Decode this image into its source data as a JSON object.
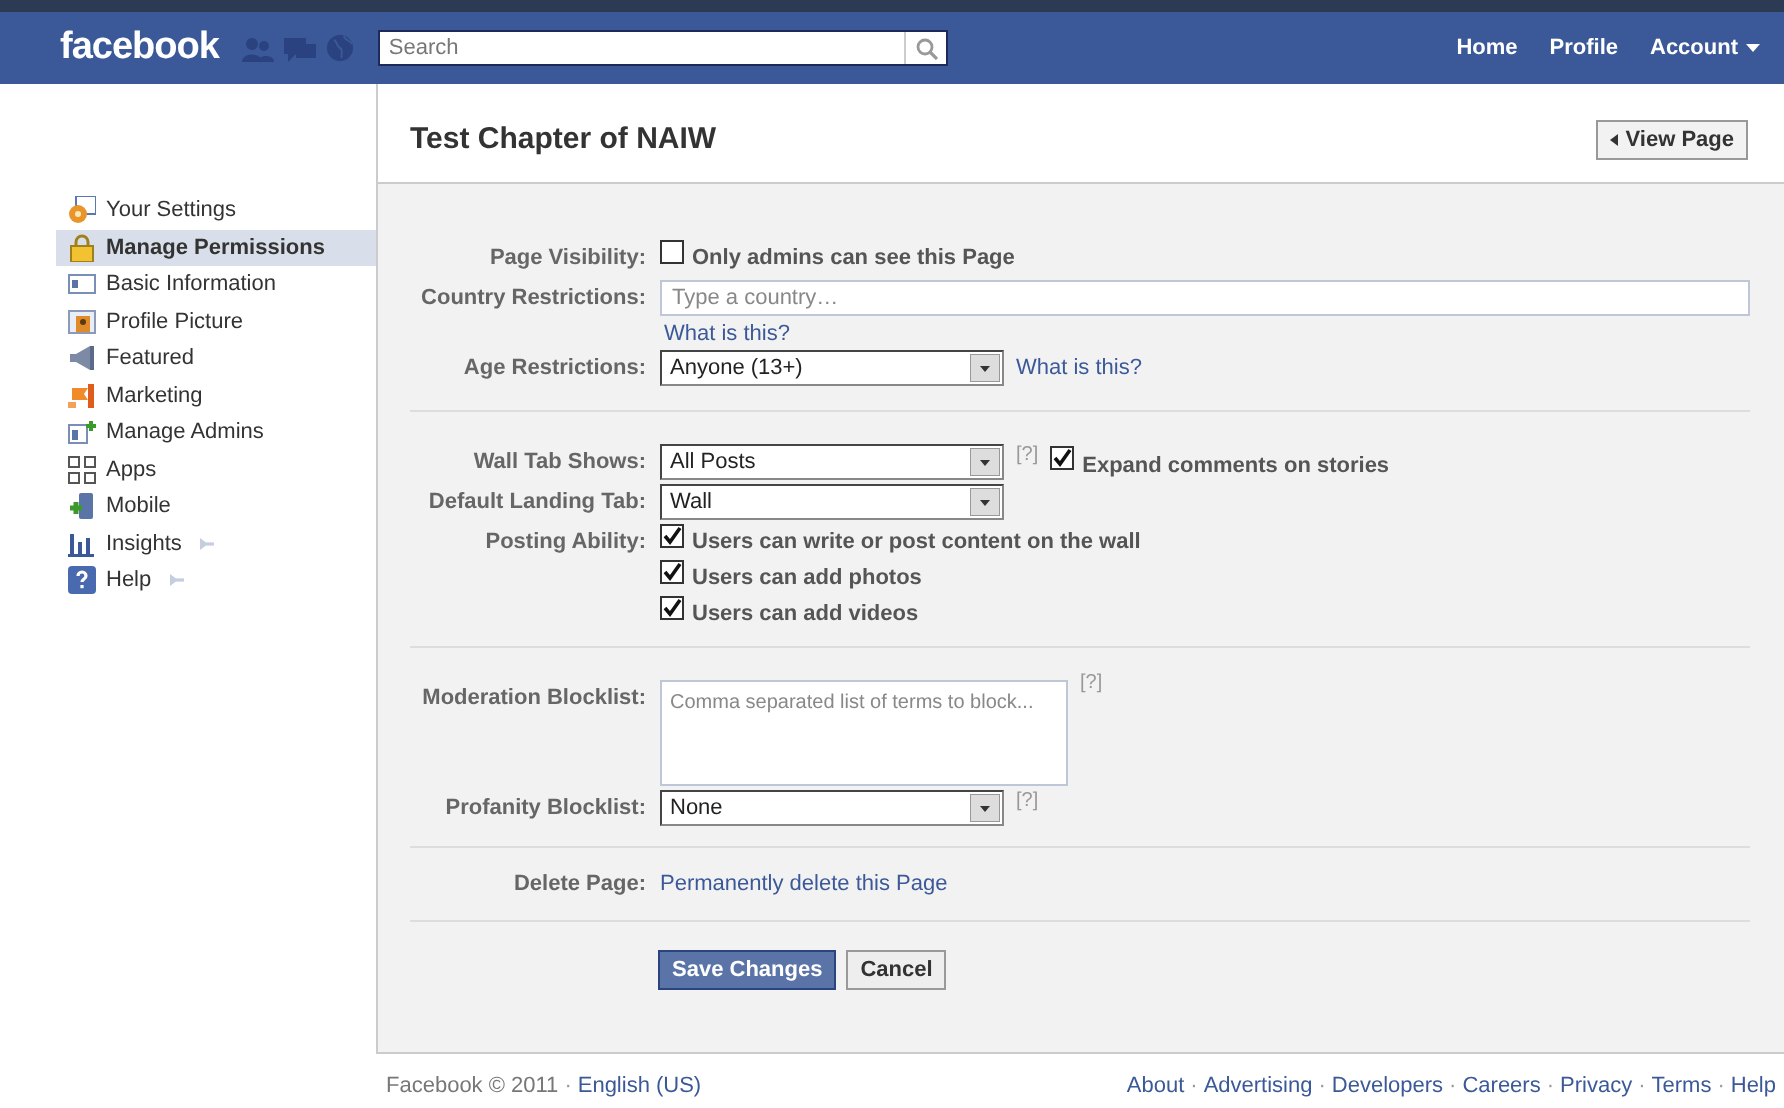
{
  "header": {
    "logo": "facebook",
    "search": {
      "placeholder": "Search"
    },
    "nav": [
      {
        "label": "Home",
        "menu": false
      },
      {
        "label": "Profile",
        "menu": false
      },
      {
        "label": "Account",
        "menu": true
      }
    ]
  },
  "sidebar": {
    "items": [
      {
        "label": "Your Settings",
        "selected": false,
        "expandable": false
      },
      {
        "label": "Manage Permissions",
        "selected": true,
        "expandable": false
      },
      {
        "label": "Basic Information",
        "selected": false,
        "expandable": false
      },
      {
        "label": "Profile Picture",
        "selected": false,
        "expandable": false
      },
      {
        "label": "Featured",
        "selected": false,
        "expandable": false
      },
      {
        "label": "Marketing",
        "selected": false,
        "expandable": false
      },
      {
        "label": "Manage Admins",
        "selected": false,
        "expandable": false
      },
      {
        "label": "Apps",
        "selected": false,
        "expandable": false
      },
      {
        "label": "Mobile",
        "selected": false,
        "expandable": false
      },
      {
        "label": "Insights",
        "selected": false,
        "expandable": true
      },
      {
        "label": "Help",
        "selected": false,
        "expandable": true
      }
    ]
  },
  "page": {
    "title": "Test Chapter of NAIW",
    "view_button": "View Page"
  },
  "form": {
    "sections": [
      {
        "rows": [
          {
            "kind": "checkbox",
            "label": "Page Visibility:",
            "options": [
              {
                "text": "Only admins can see this Page",
                "checked": false
              }
            ]
          },
          {
            "kind": "text",
            "label": "Country Restrictions:",
            "placeholder": "Type a country…",
            "help_link": "What is this?"
          },
          {
            "kind": "select",
            "label": "Age Restrictions:",
            "value": "Anyone (13+)",
            "help_link": "What is this?"
          }
        ]
      },
      {
        "rows": [
          {
            "kind": "select",
            "label": "Wall Tab Shows:",
            "value": "All Posts",
            "hint": "[?]",
            "checkbox": {
              "text": "Expand comments on stories",
              "checked": true
            }
          },
          {
            "kind": "select",
            "label": "Default Landing Tab:",
            "value": "Wall"
          },
          {
            "kind": "checkbox",
            "label": "Posting Ability:",
            "options": [
              {
                "text": "Users can write or post content on the wall",
                "checked": true
              },
              {
                "text": "Users can add photos",
                "checked": true
              },
              {
                "text": "Users can add videos",
                "checked": true
              }
            ]
          }
        ]
      },
      {
        "rows": [
          {
            "kind": "textarea",
            "label": "Moderation Blocklist:",
            "placeholder": "Comma separated list of terms to block...",
            "hint": "[?]"
          },
          {
            "kind": "select",
            "label": "Profanity Blocklist:",
            "value": "None",
            "hint": "[?]"
          }
        ]
      },
      {
        "rows": [
          {
            "kind": "link",
            "label": "Delete Page:",
            "text": "Permanently delete this Page"
          }
        ]
      }
    ],
    "buttons": [
      {
        "label": "Save Changes",
        "kind": "primary"
      },
      {
        "label": "Cancel",
        "kind": "secondary"
      }
    ]
  },
  "footer": {
    "left": [
      {
        "kind": "text",
        "text": "Facebook © 2011"
      },
      {
        "kind": "sep",
        "text": "·"
      },
      {
        "kind": "link",
        "text": "English (US)"
      }
    ],
    "right": [
      {
        "kind": "link",
        "text": "About"
      },
      {
        "kind": "sep",
        "text": "·"
      },
      {
        "kind": "link",
        "text": "Advertising"
      },
      {
        "kind": "sep",
        "text": "·"
      },
      {
        "kind": "link",
        "text": "Developers"
      },
      {
        "kind": "sep",
        "text": "·"
      },
      {
        "kind": "link",
        "text": "Careers"
      },
      {
        "kind": "sep",
        "text": "·"
      },
      {
        "kind": "link",
        "text": "Privacy"
      },
      {
        "kind": "sep",
        "text": "·"
      },
      {
        "kind": "link",
        "text": "Terms"
      },
      {
        "kind": "sep",
        "text": "·"
      },
      {
        "kind": "link",
        "text": "Help"
      }
    ]
  }
}
